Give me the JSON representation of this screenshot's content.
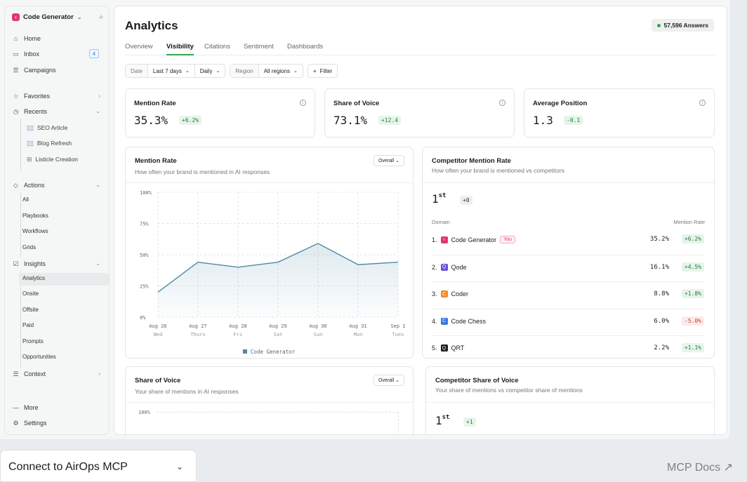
{
  "sidebar": {
    "workspace": "Code Generator",
    "home": "Home",
    "inbox": "Inbox",
    "inbox_count": "4",
    "campaigns": "Campaigns",
    "favorites": "Favorites",
    "recents": "Recents",
    "recent_items": [
      "SEO Article",
      "Blog Refresh",
      "Listicle Creation"
    ],
    "actions": "Actions",
    "action_items": [
      "All",
      "Playbooks",
      "Workflows",
      "Grids"
    ],
    "insights": "Insights",
    "insight_items": [
      "Analytics",
      "Onsite",
      "Offsite",
      "Paid",
      "Prompts",
      "Opportunities"
    ],
    "context": "Context",
    "more": "More",
    "settings": "Settings"
  },
  "header": {
    "title": "Analytics",
    "answers": "57,596 Answers",
    "tabs": [
      "Overview",
      "Visibility",
      "Citations",
      "Sentiment",
      "Dashboards"
    ],
    "active_tab": "Visibility"
  },
  "filters": {
    "date_label": "Date",
    "date_value": "Last 7 days",
    "granularity": "Daily",
    "region_label": "Region",
    "region_value": "All regions",
    "filter_button": "Filter"
  },
  "kpis": [
    {
      "title": "Mention Rate",
      "value": "35.3%",
      "delta": "+6.2%"
    },
    {
      "title": "Share of Voice",
      "value": "73.1%",
      "delta": "+12.4"
    },
    {
      "title": "Average Position",
      "value": "1.3",
      "delta": "-0.1"
    }
  ],
  "mention_chart": {
    "title": "Mention Rate",
    "subtitle": "How often your brand is mentioned in AI responses",
    "dropdown": "Overall",
    "legend": "Code Generator"
  },
  "chart_data": {
    "type": "area",
    "x": [
      "Aug 26",
      "Aug 27",
      "Aug 28",
      "Aug 29",
      "Aug 30",
      "Aug 31",
      "Sep 1"
    ],
    "x_sub": [
      "Wed",
      "Thurs",
      "Fri",
      "Sat",
      "Sun",
      "Mon",
      "Tues"
    ],
    "series": [
      {
        "name": "Code Generator",
        "values": [
          20,
          44,
          40,
          44,
          59,
          42,
          44
        ]
      }
    ],
    "yticks": [
      "100%",
      "75%",
      "50%",
      "25%",
      "0%"
    ],
    "ylim": [
      0,
      100
    ],
    "grid": true,
    "legend_position": "bottom",
    "color": "#4d8aa6"
  },
  "competitor_mention": {
    "title": "Competitor Mention Rate",
    "subtitle": "How often your brand is mentioned vs competitors",
    "rank": "1",
    "rank_suffix": "st",
    "rank_delta": "+0",
    "col_domain": "Domain",
    "col_rate": "Mention Rate",
    "you_badge": "You",
    "rows": [
      {
        "num": "1.",
        "name": "Code Generator",
        "value": "35.2%",
        "delta": "+6.2%",
        "color": "#e0367b",
        "letter": "‹"
      },
      {
        "num": "2.",
        "name": "Qode",
        "value": "16.1%",
        "delta": "+4.5%",
        "color": "#6b4fd8",
        "letter": "Q"
      },
      {
        "num": "3.",
        "name": "Coder",
        "value": "8.8%",
        "delta": "+1.8%",
        "color": "#f08a24",
        "letter": "C"
      },
      {
        "num": "4.",
        "name": "Code Chess",
        "value": "6.0%",
        "delta": "-5.0%",
        "color": "#3a78e0",
        "letter": "C"
      },
      {
        "num": "5.",
        "name": "QRT",
        "value": "2.2%",
        "delta": "+1.1%",
        "color": "#1d1d1f",
        "letter": "Q"
      }
    ]
  },
  "share_chart": {
    "title": "Share of Voice",
    "subtitle": "Your share of mentions in AI responses",
    "dropdown": "Overall",
    "ytick_top": "100%"
  },
  "competitor_share": {
    "title": "Competitor Share of Voice",
    "subtitle": "Your share of mentions vs competitor share of mentions",
    "rank": "1",
    "rank_suffix": "st",
    "rank_delta": "+1"
  },
  "bottom": {
    "connect": "Connect to AirOps MCP",
    "docs": "MCP Docs ↗"
  }
}
